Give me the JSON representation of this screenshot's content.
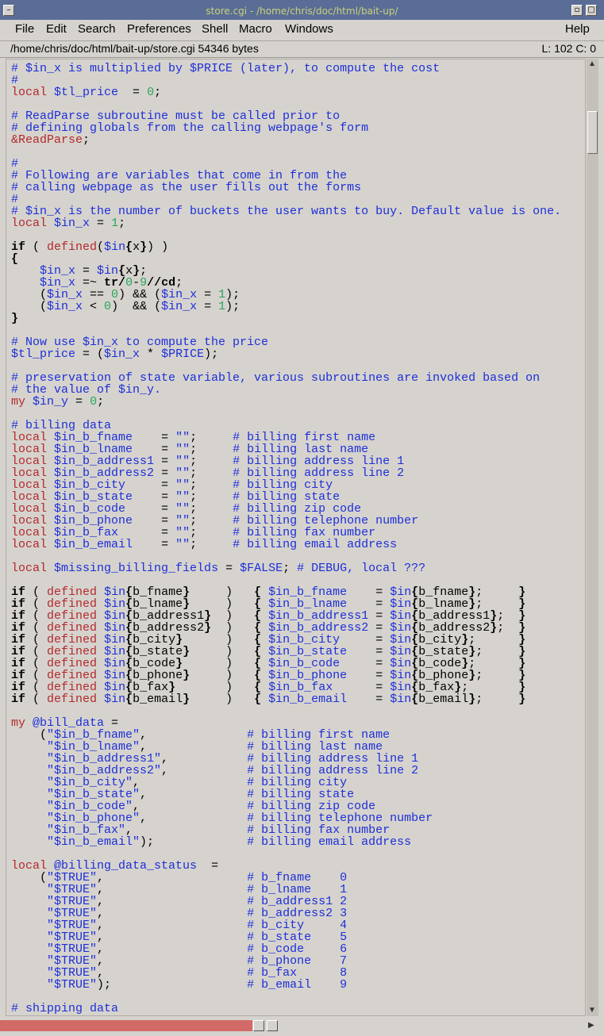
{
  "window": {
    "title": "store.cgi - /home/chris/doc/html/bait-up/"
  },
  "menu": {
    "file": "File",
    "edit": "Edit",
    "search": "Search",
    "preferences": "Preferences",
    "shell": "Shell",
    "macro": "Macro",
    "windows": "Windows",
    "help": "Help"
  },
  "status": {
    "path": "/home/chris/doc/html/bait-up/store.cgi 54346 bytes",
    "position": "L: 102  C: 0"
  },
  "editor": {
    "code": "# $in_x is multiplied by $PRICE (later), to compute the cost\n#\nlocal $tl_price  = 0;\n\n# ReadParse subroutine must be called prior to\n# defining globals from the calling webpage's form\n&ReadParse;\n\n#\n# Following are variables that come in from the\n# calling webpage as the user fills out the forms\n#\n# $in_x is the number of buckets the user wants to buy. Default value is one.\nlocal $in_x = 1;\n\nif ( defined($in{x}) )\n{\n    $in_x = $in{x};\n    $in_x =~ tr/0-9//cd;\n    ($in_x == 0) && ($in_x = 1);\n    ($in_x < 0)  && ($in_x = 1);\n}\n\n# Now use $in_x to compute the price\n$tl_price = ($in_x * $PRICE);\n\n# preservation of state variable, various subroutines are invoked based on\n# the value of $in_y.\nmy $in_y = 0;\n\n# billing data\nlocal $in_b_fname    = \"\";     # billing first name\nlocal $in_b_lname    = \"\";     # billing last name\nlocal $in_b_address1 = \"\";     # billing address line 1\nlocal $in_b_address2 = \"\";     # billing address line 2\nlocal $in_b_city     = \"\";     # billing city\nlocal $in_b_state    = \"\";     # billing state\nlocal $in_b_code     = \"\";     # billing zip code\nlocal $in_b_phone    = \"\";     # billing telephone number\nlocal $in_b_fax      = \"\";     # billing fax number\nlocal $in_b_email    = \"\";     # billing email address\n\nlocal $missing_billing_fields = $FALSE; # DEBUG, local ???\n\nif ( defined $in{b_fname}     )   { $in_b_fname    = $in{b_fname};     }\nif ( defined $in{b_lname}     )   { $in_b_lname    = $in{b_lname};     }\nif ( defined $in{b_address1}  )   { $in_b_address1 = $in{b_address1};  }\nif ( defined $in{b_address2}  )   { $in_b_address2 = $in{b_address2};  }\nif ( defined $in{b_city}      )   { $in_b_city     = $in{b_city};      }\nif ( defined $in{b_state}     )   { $in_b_state    = $in{b_state};     }\nif ( defined $in{b_code}      )   { $in_b_code     = $in{b_code};      }\nif ( defined $in{b_phone}     )   { $in_b_phone    = $in{b_phone};     }\nif ( defined $in{b_fax}       )   { $in_b_fax      = $in{b_fax};       }\nif ( defined $in{b_email}     )   { $in_b_email    = $in{b_email};     }\n\nmy @bill_data =\n    (\"$in_b_fname\",              # billing first name\n     \"$in_b_lname\",              # billing last name\n     \"$in_b_address1\",           # billing address line 1\n     \"$in_b_address2\",           # billing address line 2\n     \"$in_b_city\",               # billing city\n     \"$in_b_state\",              # billing state\n     \"$in_b_code\",               # billing zip code\n     \"$in_b_phone\",              # billing telephone number\n     \"$in_b_fax\",                # billing fax number\n     \"$in_b_email\");             # billing email address\n\nlocal @billing_data_status  =\n    (\"$TRUE\",                    # b_fname    0\n     \"$TRUE\",                    # b_lname    1\n     \"$TRUE\",                    # b_address1 2\n     \"$TRUE\",                    # b_address2 3\n     \"$TRUE\",                    # b_city     4\n     \"$TRUE\",                    # b_state    5\n     \"$TRUE\",                    # b_code     6\n     \"$TRUE\",                    # b_phone    7\n     \"$TRUE\",                    # b_fax      8\n     \"$TRUE\");                   # b_email    9\n\n# shipping data"
  },
  "colors": {
    "comment": "#1d2fd8",
    "keyword": "#b3292d",
    "number": "#28a65b",
    "background": "#d6d3ce"
  }
}
